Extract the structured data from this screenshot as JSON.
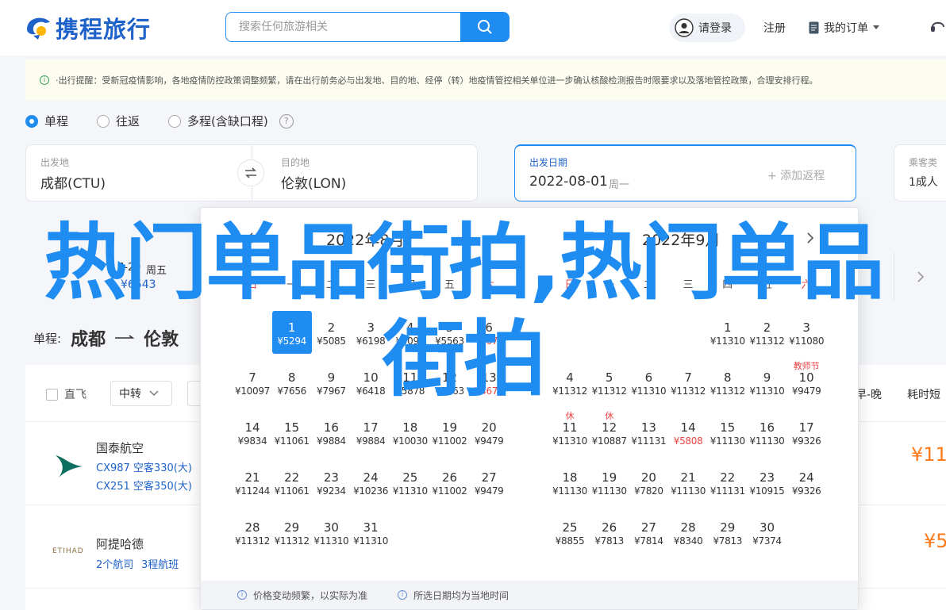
{
  "header": {
    "logo_text": "携程旅行",
    "search_placeholder": "搜索任何旅游相关",
    "login_label": "请登录",
    "register_label": "注册",
    "orders_label": "我的订单"
  },
  "notice": {
    "text": "·出行提醒：受新冠疫情影响，各地疫情防控政策调整频繁，请在出行前务必与出发地、目的地、经停（转）地疫情管控相关单位进一步确认核酸检测报告时限要求以及落地管控政策，合理安排行程。"
  },
  "trip_types": [
    {
      "label": "单程",
      "selected": true
    },
    {
      "label": "往返",
      "selected": false
    },
    {
      "label": "多程(含缺口程)",
      "selected": false
    }
  ],
  "form": {
    "from_label": "出发地",
    "from_value": "成都(CTU)",
    "to_label": "目的地",
    "to_value": "伦敦(LON)",
    "date_label": "出发日期",
    "date_value": "2022-08-01",
    "date_weekday": "周一",
    "add_return": "+ 添加返程",
    "passenger_label": "乘客类",
    "passenger_value": "1成人"
  },
  "date_strip": {
    "date": "7-29",
    "weekday": "周五",
    "price": "¥6543"
  },
  "route": {
    "prefix": "单程:",
    "from": "成都",
    "to": "伦敦"
  },
  "filters": {
    "direct_label": "直飞",
    "transfer_label": "中转",
    "sort_early": "早-晚",
    "sort_duration": "耗时短"
  },
  "flights": [
    {
      "airline": "国泰航空",
      "legs": [
        "CX987 空客330(大)",
        "CX251 空客350(大)"
      ],
      "price": "¥11"
    },
    {
      "airline": "阿提哈德",
      "legs": [
        "2个航司",
        "3程航班"
      ],
      "price": "¥5",
      "logo_text": "ETIHAD"
    }
  ],
  "calendar": {
    "weekdays": [
      "日",
      "一",
      "二",
      "三",
      "四",
      "五",
      "六"
    ],
    "left_month": {
      "title": "2022年8月",
      "days": [
        {
          "d": "1",
          "p": "¥5294",
          "col": 1,
          "row": 0,
          "sel": true
        },
        {
          "d": "2",
          "p": "¥5085",
          "col": 2,
          "row": 0
        },
        {
          "d": "3",
          "p": "¥6198",
          "col": 3,
          "row": 0
        },
        {
          "d": "4",
          "p": "¥5098",
          "col": 4,
          "row": 0
        },
        {
          "d": "5",
          "p": "¥5563",
          "col": 5,
          "row": 0
        },
        {
          "d": "6",
          "p": "¥4674",
          "col": 6,
          "row": 0,
          "low": true
        },
        {
          "d": "7",
          "p": "¥10097",
          "col": 0,
          "row": 1
        },
        {
          "d": "8",
          "p": "¥7656",
          "col": 1,
          "row": 1
        },
        {
          "d": "9",
          "p": "¥7967",
          "col": 2,
          "row": 1
        },
        {
          "d": "10",
          "p": "¥6418",
          "col": 3,
          "row": 1
        },
        {
          "d": "11",
          "p": "¥5878",
          "col": 4,
          "row": 1
        },
        {
          "d": "12",
          "p": "¥5563",
          "col": 5,
          "row": 1
        },
        {
          "d": "13",
          "p": "¥4674",
          "col": 6,
          "row": 1,
          "low": true
        },
        {
          "d": "14",
          "p": "¥9834",
          "col": 0,
          "row": 2
        },
        {
          "d": "15",
          "p": "¥11061",
          "col": 1,
          "row": 2
        },
        {
          "d": "16",
          "p": "¥9884",
          "col": 2,
          "row": 2
        },
        {
          "d": "17",
          "p": "¥9884",
          "col": 3,
          "row": 2
        },
        {
          "d": "18",
          "p": "¥10030",
          "col": 4,
          "row": 2
        },
        {
          "d": "19",
          "p": "¥11002",
          "col": 5,
          "row": 2
        },
        {
          "d": "20",
          "p": "¥9479",
          "col": 6,
          "row": 2
        },
        {
          "d": "21",
          "p": "¥11244",
          "col": 0,
          "row": 3
        },
        {
          "d": "22",
          "p": "¥11061",
          "col": 1,
          "row": 3
        },
        {
          "d": "23",
          "p": "¥9234",
          "col": 2,
          "row": 3
        },
        {
          "d": "24",
          "p": "¥10236",
          "col": 3,
          "row": 3
        },
        {
          "d": "25",
          "p": "¥11310",
          "col": 4,
          "row": 3
        },
        {
          "d": "26",
          "p": "¥11002",
          "col": 5,
          "row": 3
        },
        {
          "d": "27",
          "p": "¥9479",
          "col": 6,
          "row": 3
        },
        {
          "d": "28",
          "p": "¥11312",
          "col": 0,
          "row": 4
        },
        {
          "d": "29",
          "p": "¥11312",
          "col": 1,
          "row": 4
        },
        {
          "d": "30",
          "p": "¥11310",
          "col": 2,
          "row": 4
        },
        {
          "d": "31",
          "p": "¥11310",
          "col": 3,
          "row": 4
        }
      ]
    },
    "right_month": {
      "title": "2022年9月",
      "days": [
        {
          "d": "1",
          "p": "¥11310",
          "col": 4,
          "row": 0
        },
        {
          "d": "2",
          "p": "¥11312",
          "col": 5,
          "row": 0
        },
        {
          "d": "3",
          "p": "¥11080",
          "col": 6,
          "row": 0
        },
        {
          "d": "4",
          "p": "¥11312",
          "col": 0,
          "row": 1
        },
        {
          "d": "5",
          "p": "¥11312",
          "col": 1,
          "row": 1
        },
        {
          "d": "6",
          "p": "¥11310",
          "col": 2,
          "row": 1
        },
        {
          "d": "7",
          "p": "¥11312",
          "col": 3,
          "row": 1
        },
        {
          "d": "8",
          "p": "¥11312",
          "col": 4,
          "row": 1
        },
        {
          "d": "9",
          "p": "¥11310",
          "col": 5,
          "row": 1
        },
        {
          "d": "10",
          "p": "¥9479",
          "col": 6,
          "row": 1,
          "tag": "教师节"
        },
        {
          "d": "11",
          "p": "¥11310",
          "col": 0,
          "row": 2,
          "tag": "休"
        },
        {
          "d": "12",
          "p": "¥10887",
          "col": 1,
          "row": 2,
          "tag": "休"
        },
        {
          "d": "13",
          "p": "¥11131",
          "col": 2,
          "row": 2
        },
        {
          "d": "14",
          "p": "¥5808",
          "col": 3,
          "row": 2,
          "low": true
        },
        {
          "d": "15",
          "p": "¥11130",
          "col": 4,
          "row": 2
        },
        {
          "d": "16",
          "p": "¥11130",
          "col": 5,
          "row": 2
        },
        {
          "d": "17",
          "p": "¥9326",
          "col": 6,
          "row": 2
        },
        {
          "d": "18",
          "p": "¥11130",
          "col": 0,
          "row": 3
        },
        {
          "d": "19",
          "p": "¥11130",
          "col": 1,
          "row": 3
        },
        {
          "d": "20",
          "p": "¥7820",
          "col": 2,
          "row": 3
        },
        {
          "d": "21",
          "p": "¥11130",
          "col": 3,
          "row": 3
        },
        {
          "d": "22",
          "p": "¥11131",
          "col": 4,
          "row": 3
        },
        {
          "d": "23",
          "p": "¥10915",
          "col": 5,
          "row": 3
        },
        {
          "d": "24",
          "p": "¥9326",
          "col": 6,
          "row": 3
        },
        {
          "d": "25",
          "p": "¥8855",
          "col": 0,
          "row": 4
        },
        {
          "d": "26",
          "p": "¥7813",
          "col": 1,
          "row": 4
        },
        {
          "d": "27",
          "p": "¥7814",
          "col": 2,
          "row": 4
        },
        {
          "d": "28",
          "p": "¥8340",
          "col": 3,
          "row": 4
        },
        {
          "d": "29",
          "p": "¥7813",
          "col": 4,
          "row": 4
        },
        {
          "d": "30",
          "p": "¥7374",
          "col": 5,
          "row": 4
        }
      ]
    },
    "footer": [
      "价格变动频繁，以实际为准",
      "所选日期均为当地时间"
    ]
  },
  "overlay_text": "热门单品街拍,热门单品街拍",
  "colors": {
    "brand": "#1f8cf2",
    "logo": "#1f62c9",
    "price": "#ff7a1a",
    "holiday": "#e94444"
  }
}
